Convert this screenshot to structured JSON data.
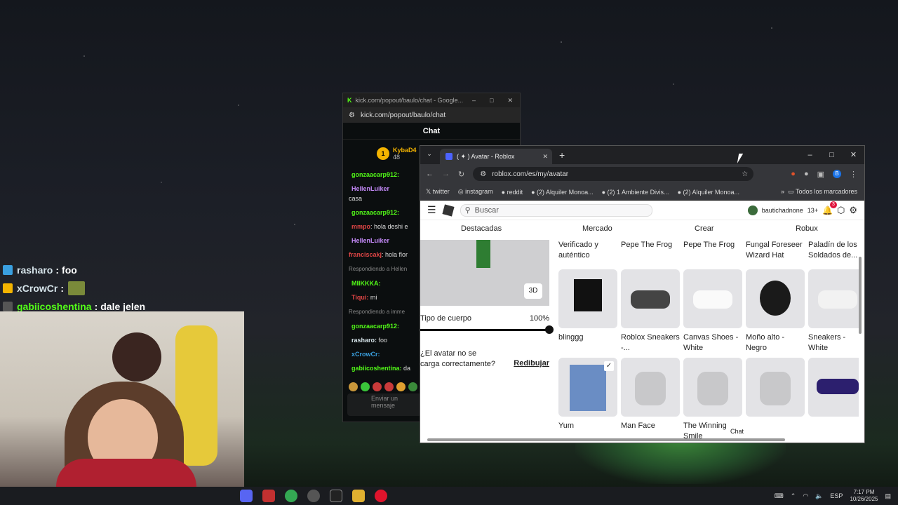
{
  "overlay_chat": [
    {
      "user": "rasharo",
      "sep": ":",
      "msg": "foo"
    },
    {
      "user": "xCrowCr",
      "sep": ":",
      "msg": ""
    },
    {
      "user": "gabiicoshentina",
      "sep": ":",
      "msg": "dale jelen"
    }
  ],
  "kick_window": {
    "title": "kick.com/popout/baulo/chat - Google...",
    "url": "kick.com/popout/baulo/chat",
    "chat_header": "Chat",
    "pinned_user": "KybaD4",
    "pinned_count": "48",
    "messages": [
      {
        "user": "gonzaacarp912:",
        "msg": ""
      },
      {
        "user": "HellenLuiker",
        "msg": "casa"
      },
      {
        "user": "gonzaacarp912:",
        "msg": ""
      },
      {
        "user": "mmpo",
        "msg": ": hola deshi e"
      },
      {
        "user": "HellenLuiker",
        "msg": ""
      },
      {
        "user": "franciscakj",
        "msg": ": hola flor"
      },
      {
        "user": "Respondiendo a Hellen",
        "msg": ""
      },
      {
        "user": "MIIKKKA:",
        "msg": ""
      },
      {
        "user": "Tiqui:",
        "msg": "mi"
      },
      {
        "user": "Respondiendo a imme",
        "msg": ""
      },
      {
        "user": "gonzaacarp912:",
        "msg": ""
      },
      {
        "user": "rasharo:",
        "msg": "foo"
      },
      {
        "user": "xCrowCr:",
        "msg": ""
      },
      {
        "user": "gabiicoshentina:",
        "msg": "da"
      }
    ],
    "input_placeholder": "Enviar un mensaje"
  },
  "browser": {
    "tab_title": "( ✦ ) Avatar - Roblox",
    "url": "roblox.com/es/my/avatar",
    "bookmarks": [
      "twitter",
      "instagram",
      "reddit",
      "(2) Alquiler Monoa...",
      "(2) 1 Ambiente Divis...",
      "(2) Alquiler Monoa..."
    ],
    "all_bookmarks": "Todos los marcadores",
    "profile_initial": "B"
  },
  "roblox": {
    "search_placeholder": "Buscar",
    "username": "bautichadnone",
    "age": "13+",
    "notif_count": "3",
    "tabs": [
      "Destacadas",
      "Mercado",
      "Crear",
      "Robux"
    ],
    "btn_3d": "3D",
    "body_type_label": "Tipo de cuerpo",
    "body_type_value": "100%",
    "warning": "¿El avatar no se carga correctamente?",
    "redraw": "Redibujar",
    "top_labels": [
      "Verificado y auténtico",
      "Pepe The Frog",
      "Pepe The Frog",
      "Fungal Foreseer Wizard Hat",
      "Paladín de los Soldados de..."
    ],
    "row1": [
      "blinggg",
      "Roblox Sneakers -...",
      "Canvas Shoes - White",
      "Moño alto - Negro",
      "Sneakers - White"
    ],
    "row2": [
      "Yum",
      "Man Face",
      "The Winning Smile",
      "",
      ""
    ],
    "chat_label": "Chat"
  },
  "taskbar": {
    "lang": "ESP",
    "time": "7:17 PM",
    "date": "10/26/2025"
  }
}
